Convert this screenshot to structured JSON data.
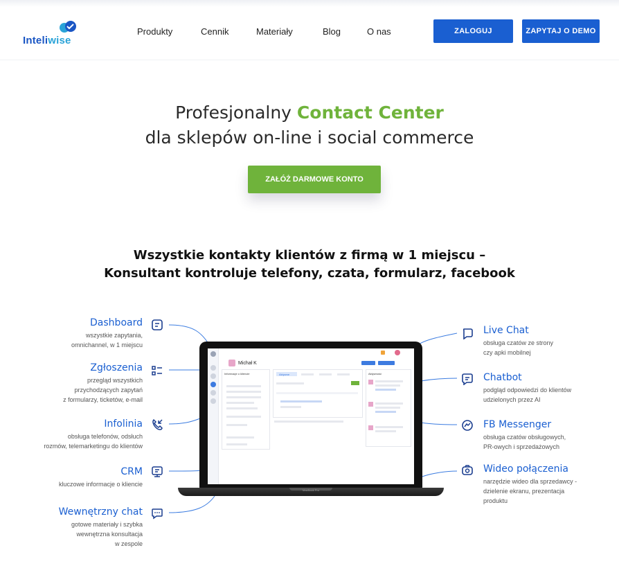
{
  "brand": {
    "name_part1": "Inteli",
    "name_part2": "wise",
    "color": "#1a56c4"
  },
  "nav": {
    "items": [
      "Produkty",
      "Cennik",
      "Materiały",
      "Blog",
      "O nas"
    ],
    "login": "ZALOGUJ",
    "demo": "ZAPYTAJ O DEMO"
  },
  "hero": {
    "title_part1": "Profesjonalny ",
    "title_highlight": "Contact Center",
    "title_line2": "dla sklepów on-line i social commerce",
    "cta": "ZAŁÓŻ DARMOWE KONTO"
  },
  "section": {
    "line1": "Wszystkie kontakty klientów z firmą w 1 miejscu –",
    "line2": "Konsultant kontroluje telefony, czata, formularz, facebook"
  },
  "features_left": [
    {
      "title": "Dashboard",
      "desc": [
        "wszystkie zapytania,",
        "omnichannel, w 1 miejscu"
      ],
      "icon": "dashboard-icon"
    },
    {
      "title": "Zgłoszenia",
      "desc": [
        "przegląd wszystkich",
        "przychodzących zapytań",
        "z formularzy, ticketów, e-mail"
      ],
      "icon": "tickets-icon"
    },
    {
      "title": "Infolinia",
      "desc": [
        "obsługa telefonów, odsłuch",
        "rozmów, telemarketingu do klientów"
      ],
      "icon": "phone-icon"
    },
    {
      "title": "CRM",
      "desc": [
        "kluczowe informacje o kliencie"
      ],
      "icon": "crm-icon"
    },
    {
      "title": "Wewnętrzny chat",
      "desc": [
        "gotowe materiały i szybka",
        "wewnętrzna konsultacja",
        "w zespole"
      ],
      "icon": "internal-chat-icon"
    }
  ],
  "features_right": [
    {
      "title": "Live Chat",
      "desc": [
        "obsługa czatów ze strony",
        "czy apki mobilnej"
      ],
      "icon": "live-chat-icon"
    },
    {
      "title": "Chatbot",
      "desc": [
        "podgląd odpowiedzi do klientów",
        "udzielonych przez AI"
      ],
      "icon": "chatbot-icon"
    },
    {
      "title": "FB Messenger",
      "desc": [
        "obsługa czatów obsługowych,",
        "PR-owych i sprzedażowych"
      ],
      "icon": "messenger-icon"
    },
    {
      "title": "Wideo połączenia",
      "desc": [
        "narzędzie wideo dla sprzedawcy -",
        "dzielenie ekranu, prezentacja",
        "produktu"
      ],
      "icon": "video-icon"
    }
  ],
  "screen": {
    "user": "Michał K",
    "panel_title": "Informacje o kliencie",
    "tab_active": "Aktywne",
    "chat_title": "Aktywność",
    "laptop_label": "MacBook Pro"
  },
  "colors": {
    "blue": "#1a5fd1",
    "green": "#6fb33b"
  }
}
